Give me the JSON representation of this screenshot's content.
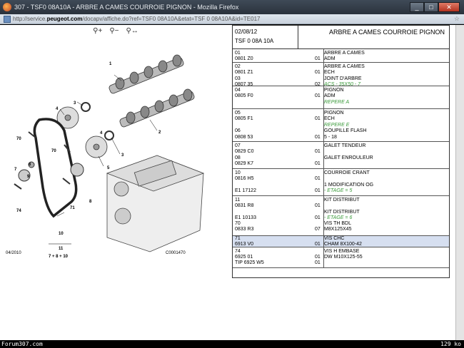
{
  "window": {
    "title": "307 - TSF0 08A10A - ARBRE A CAMES COURROIE PIGNON - Mozilla Firefox",
    "controls": {
      "minimize": "_",
      "maximize": "□",
      "close": "✕"
    }
  },
  "address": {
    "url_prefix": "http://service.",
    "url_domain": "peugeot.com",
    "url_suffix": "/docapv/affiche.do?ref=TSF0 08A10A&etat=TSF 0 08A10A&id=TE017"
  },
  "diagram": {
    "tools": [
      "zoom-in",
      "zoom-out",
      "zoom-fit"
    ],
    "labels": [
      {
        "text": "1"
      },
      {
        "text": "2"
      },
      {
        "text": "3"
      },
      {
        "text": "3"
      },
      {
        "text": "4"
      },
      {
        "text": "4"
      },
      {
        "text": "5"
      },
      {
        "text": "6"
      },
      {
        "text": "7"
      },
      {
        "text": "8"
      },
      {
        "text": "9"
      },
      {
        "text": "10"
      },
      {
        "text": "70"
      },
      {
        "text": "70"
      },
      {
        "text": "71"
      },
      {
        "text": "74"
      }
    ],
    "formula_top": "11",
    "formula_bottom": "7 + 8 + 10",
    "date": "04/2010",
    "code": "C0001470"
  },
  "header": {
    "date": "02/08/12",
    "ref": "TSF 0 08A 10A",
    "title": "ARBRE A CAMES COURROIE PIGNON"
  },
  "rows": [
    {
      "h": 19,
      "highlight": false,
      "items": [
        {
          "t": 2,
          "c1": "01",
          "c2": "",
          "c3": "ARBRE A CAMES"
        },
        {
          "t": 10,
          "c1": "0801 Z0",
          "c2": "01",
          "c3": "ADM",
          "green": false
        }
      ]
    },
    {
      "h": 33,
      "highlight": false,
      "items": [
        {
          "t": 2,
          "c1": "02",
          "c2": "",
          "c3": "ARBRE A CAMES"
        },
        {
          "t": 10,
          "c1": "0801 Z1",
          "c2": "01",
          "c3": "ECH"
        },
        {
          "t": 19,
          "c1": "03",
          "c2": "",
          "c3": "JOINT D'ARBRE"
        },
        {
          "t": 27,
          "c1": "0807 35",
          "c2": "02",
          "c3": "ACS - 35X50 - 7",
          "green": true
        }
      ]
    },
    {
      "h": 32,
      "highlight": false,
      "items": [
        {
          "t": 2,
          "c1": "04",
          "c2": "",
          "c3": "PIGNON"
        },
        {
          "t": 10,
          "c1": "0805 F0",
          "c2": "01",
          "c3": "ADM"
        },
        {
          "t": 19,
          "c1": "",
          "c2": "",
          "c3": "REPERE A",
          "green": true
        }
      ]
    },
    {
      "h": 46,
      "highlight": false,
      "items": [
        {
          "t": 2,
          "c1": "05",
          "c2": "",
          "c3": "PIGNON"
        },
        {
          "t": 10,
          "c1": "0805 F1",
          "c2": "01",
          "c3": "ECH"
        },
        {
          "t": 19,
          "c1": "",
          "c2": "",
          "c3": "REPERE E",
          "green": true
        },
        {
          "t": 27,
          "c1": "06",
          "c2": "",
          "c3": "GOUPILLE FLASH"
        },
        {
          "t": 36,
          "c1": "0808 53",
          "c2": "01",
          "c3": "5 - 18"
        }
      ]
    },
    {
      "h": 38,
      "highlight": false,
      "items": [
        {
          "t": 2,
          "c1": "07",
          "c2": "",
          "c3": "GALET TENDEUR"
        },
        {
          "t": 10,
          "c1": "0829 C0",
          "c2": "01",
          "c3": ""
        },
        {
          "t": 19,
          "c1": "08",
          "c2": "",
          "c3": "GALET ENROULEUR"
        },
        {
          "t": 27,
          "c1": "0829 K7",
          "c2": "01",
          "c3": ""
        }
      ]
    },
    {
      "h": 38,
      "highlight": false,
      "items": [
        {
          "t": 2,
          "c1": "10",
          "c2": "",
          "c3": "COURROIE CRANT"
        },
        {
          "t": 10,
          "c1": "0816 H5",
          "c2": "01",
          "c3": ""
        },
        {
          "t": 19,
          "c1": "",
          "c2": "",
          "c3": "1 MODIFICATION OG"
        },
        {
          "t": 27,
          "c1": "E1 17122",
          "c2": "01",
          "c3": "- ETAGE = 5",
          "green": true
        }
      ]
    },
    {
      "h": 56,
      "highlight": false,
      "items": [
        {
          "t": 2,
          "c1": "11",
          "c2": "",
          "c3": "KIT DISTRIBUT"
        },
        {
          "t": 10,
          "c1": "0831 R8",
          "c2": "01",
          "c3": ""
        },
        {
          "t": 19,
          "c1": "",
          "c2": "",
          "c3": "KIT DISTRIBUT"
        },
        {
          "t": 27,
          "c1": "E1 10133",
          "c2": "01",
          "c3": "- ETAGE = 6",
          "green": true
        },
        {
          "t": 35,
          "c1": "70",
          "c2": "",
          "c3": "VIS TH BDL"
        },
        {
          "t": 43,
          "c1": "0833 R3",
          "c2": "07",
          "c3": "M8X125X45"
        }
      ]
    },
    {
      "h": 16,
      "highlight": true,
      "items": [
        {
          "t": 0,
          "c1": "71",
          "c2": "",
          "c3": "VIS CHC"
        },
        {
          "t": 8,
          "c1": "6913 V0",
          "c2": "01",
          "c3": "CHAM 8X100-42"
        }
      ]
    },
    {
      "h": 29,
      "highlight": false,
      "items": [
        {
          "t": 2,
          "c1": "74",
          "c2": "",
          "c3": "VIS H EMBASE"
        },
        {
          "t": 10,
          "c1": "6925 01",
          "c2": "01",
          "c3": "DW M10X125-55"
        },
        {
          "t": 18,
          "c1": "TIP 6925 W5",
          "c2": "01",
          "c3": ""
        }
      ]
    }
  ],
  "status": {
    "left": "Forum307.com",
    "right": "129 ko"
  }
}
